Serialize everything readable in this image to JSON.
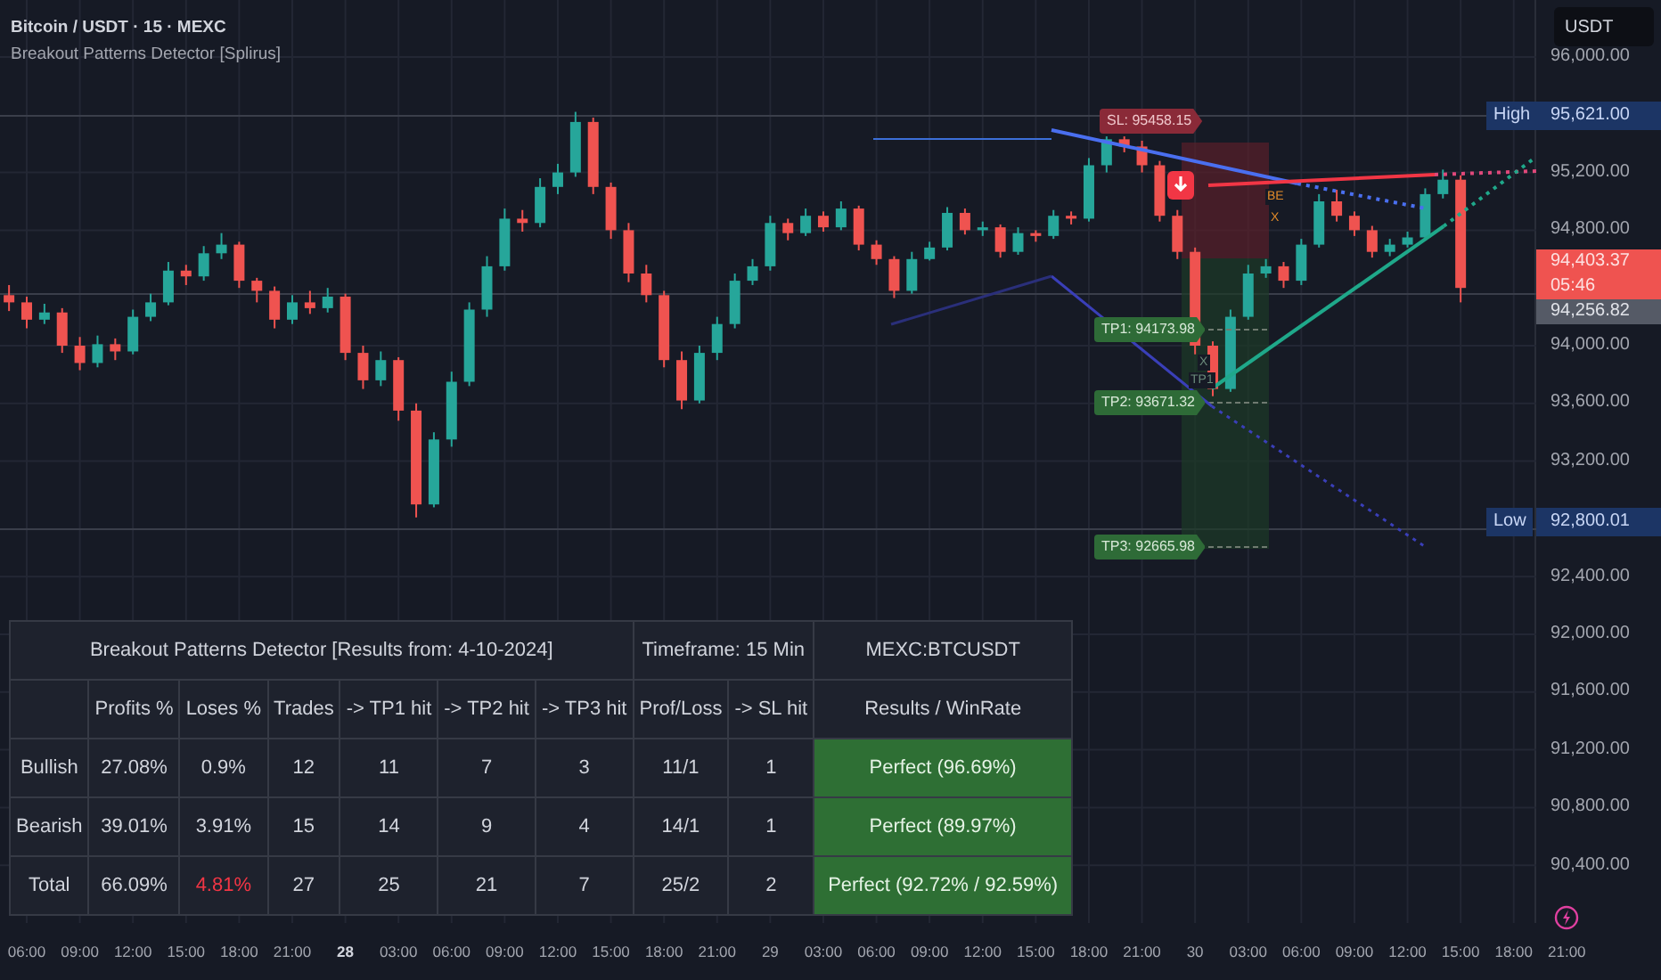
{
  "header": {
    "symbol": "Bitcoin / USDT · 15 · MEXC",
    "indicator": "Breakout Patterns Detector [Splirus]"
  },
  "price_chart": {
    "chart_data": {
      "type": "candlestick",
      "categories": [
        null,
        null,
        null,
        null,
        null,
        null,
        null,
        null,
        null,
        null,
        null,
        null,
        null,
        null,
        null,
        null,
        null,
        null,
        null,
        null,
        null,
        null,
        null,
        null,
        null,
        null,
        null,
        null,
        null,
        null,
        null,
        null,
        null,
        null,
        null,
        null,
        null,
        null,
        null,
        null,
        null,
        null,
        null,
        null,
        null,
        null,
        null,
        null,
        null,
        null,
        null,
        null,
        null,
        null,
        null,
        null,
        null,
        null,
        null,
        null,
        null,
        null,
        null,
        null,
        null,
        null,
        null,
        null,
        null,
        null,
        null,
        null,
        null,
        null,
        null,
        null,
        null,
        null,
        null,
        null,
        null,
        null,
        null
      ],
      "ohlc": [
        [
          94350,
          94420,
          94240,
          94300
        ],
        [
          94300,
          94340,
          94120,
          94180
        ],
        [
          94180,
          94290,
          94150,
          94230
        ],
        [
          94230,
          94260,
          93950,
          94000
        ],
        [
          94000,
          94060,
          93830,
          93880
        ],
        [
          93880,
          94070,
          93850,
          94010
        ],
        [
          94010,
          94050,
          93900,
          93960
        ],
        [
          93960,
          94250,
          93940,
          94200
        ],
        [
          94200,
          94360,
          94170,
          94300
        ],
        [
          94300,
          94580,
          94280,
          94520
        ],
        [
          94520,
          94560,
          94420,
          94480
        ],
        [
          94480,
          94690,
          94450,
          94640
        ],
        [
          94640,
          94780,
          94600,
          94700
        ],
        [
          94700,
          94720,
          94400,
          94450
        ],
        [
          94450,
          94470,
          94300,
          94380
        ],
        [
          94380,
          94410,
          94120,
          94180
        ],
        [
          94180,
          94350,
          94150,
          94300
        ],
        [
          94300,
          94380,
          94220,
          94260
        ],
        [
          94260,
          94400,
          94230,
          94340
        ],
        [
          94340,
          94360,
          93900,
          93950
        ],
        [
          93950,
          94000,
          93700,
          93760
        ],
        [
          93760,
          93960,
          93720,
          93900
        ],
        [
          93900,
          93920,
          93480,
          93550
        ],
        [
          93550,
          93600,
          92810,
          92900
        ],
        [
          92900,
          93400,
          92880,
          93350
        ],
        [
          93350,
          93820,
          93300,
          93750
        ],
        [
          93750,
          94300,
          93720,
          94250
        ],
        [
          94250,
          94620,
          94200,
          94550
        ],
        [
          94550,
          94950,
          94520,
          94880
        ],
        [
          94880,
          94940,
          94790,
          94850
        ],
        [
          94850,
          95160,
          94820,
          95100
        ],
        [
          95100,
          95260,
          95050,
          95200
        ],
        [
          95200,
          95620,
          95170,
          95550
        ],
        [
          95550,
          95580,
          95050,
          95100
        ],
        [
          95100,
          95130,
          94740,
          94800
        ],
        [
          94800,
          94850,
          94440,
          94500
        ],
        [
          94500,
          94560,
          94300,
          94350
        ],
        [
          94350,
          94380,
          93850,
          93900
        ],
        [
          93900,
          93960,
          93560,
          93620
        ],
        [
          93620,
          94000,
          93600,
          93950
        ],
        [
          93950,
          94200,
          93900,
          94150
        ],
        [
          94150,
          94500,
          94120,
          94450
        ],
        [
          94450,
          94600,
          94420,
          94550
        ],
        [
          94550,
          94900,
          94520,
          94850
        ],
        [
          94850,
          94880,
          94730,
          94780
        ],
        [
          94780,
          94950,
          94760,
          94900
        ],
        [
          94900,
          94930,
          94790,
          94820
        ],
        [
          94820,
          95000,
          94800,
          94950
        ],
        [
          94950,
          94970,
          94660,
          94700
        ],
        [
          94700,
          94730,
          94560,
          94600
        ],
        [
          94600,
          94620,
          94330,
          94380
        ],
        [
          94380,
          94650,
          94360,
          94600
        ],
        [
          94600,
          94720,
          94590,
          94680
        ],
        [
          94680,
          94960,
          94660,
          94920
        ],
        [
          94920,
          94950,
          94770,
          94800
        ],
        [
          94800,
          94860,
          94760,
          94820
        ],
        [
          94820,
          94840,
          94610,
          94650
        ],
        [
          94650,
          94820,
          94630,
          94780
        ],
        [
          94780,
          94800,
          94720,
          94760
        ],
        [
          94760,
          94940,
          94740,
          94900
        ],
        [
          94900,
          94930,
          94840,
          94880
        ],
        [
          94880,
          95300,
          94860,
          95250
        ],
        [
          95250,
          95450,
          95200,
          95430
        ],
        [
          95430,
          95450,
          95340,
          95380
        ],
        [
          95380,
          95420,
          95200,
          95250
        ],
        [
          95250,
          95280,
          94860,
          94900
        ],
        [
          94900,
          94940,
          94600,
          94650
        ],
        [
          94650,
          94680,
          93940,
          94000
        ],
        [
          94000,
          94030,
          93650,
          93700
        ],
        [
          93700,
          94250,
          93680,
          94200
        ],
        [
          94200,
          94560,
          94180,
          94500
        ],
        [
          94500,
          94600,
          94470,
          94550
        ],
        [
          94550,
          94580,
          94400,
          94450
        ],
        [
          94450,
          94740,
          94420,
          94700
        ],
        [
          94700,
          95050,
          94680,
          95000
        ],
        [
          95000,
          95080,
          94860,
          94900
        ],
        [
          94900,
          94930,
          94760,
          94800
        ],
        [
          94800,
          94830,
          94610,
          94650
        ],
        [
          94650,
          94740,
          94620,
          94700
        ],
        [
          94700,
          94790,
          94680,
          94750
        ],
        [
          94750,
          95090,
          94730,
          95050
        ],
        [
          95050,
          95220,
          95020,
          95150
        ],
        [
          95150,
          95180,
          94300,
          94400
        ]
      ],
      "yticks": [
        {
          "value": 96000,
          "label": "96,000.00"
        },
        {
          "value": 95200,
          "label": "95,200.00"
        },
        {
          "value": 94800,
          "label": "94,800.00"
        },
        {
          "value": 94000,
          "label": "94,000.00"
        },
        {
          "value": 93600,
          "label": "93,600.00"
        },
        {
          "value": 93200,
          "label": "93,200.00"
        },
        {
          "value": 92400,
          "label": "92,400.00"
        },
        {
          "value": 92000,
          "label": "92,000.00"
        },
        {
          "value": 91600,
          "label": "91,600.00"
        },
        {
          "value": 91200,
          "label": "91,200.00"
        },
        {
          "value": 90800,
          "label": "90,800.00"
        },
        {
          "value": 90400,
          "label": "90,400.00"
        }
      ],
      "ylim": [
        90000,
        96395
      ],
      "grid": true
    },
    "time_axis": [
      {
        "text": "06:00",
        "bold": false
      },
      {
        "text": "09:00",
        "bold": false
      },
      {
        "text": "12:00",
        "bold": false
      },
      {
        "text": "15:00",
        "bold": false
      },
      {
        "text": "18:00",
        "bold": false
      },
      {
        "text": "21:00",
        "bold": false
      },
      {
        "text": "28",
        "bold": true
      },
      {
        "text": "03:00",
        "bold": false
      },
      {
        "text": "06:00",
        "bold": false
      },
      {
        "text": "09:00",
        "bold": false
      },
      {
        "text": "12:00",
        "bold": false
      },
      {
        "text": "15:00",
        "bold": false
      },
      {
        "text": "18:00",
        "bold": false
      },
      {
        "text": "21:00",
        "bold": false
      },
      {
        "text": "29",
        "bold": false
      },
      {
        "text": "03:00",
        "bold": false
      },
      {
        "text": "06:00",
        "bold": false
      },
      {
        "text": "09:00",
        "bold": false
      },
      {
        "text": "12:00",
        "bold": false
      },
      {
        "text": "15:00",
        "bold": false
      },
      {
        "text": "18:00",
        "bold": false
      },
      {
        "text": "21:00",
        "bold": false
      },
      {
        "text": "30",
        "bold": false
      },
      {
        "text": "03:00",
        "bold": false
      },
      {
        "text": "06:00",
        "bold": false
      },
      {
        "text": "09:00",
        "bold": false
      },
      {
        "text": "12:00",
        "bold": false
      },
      {
        "text": "15:00",
        "bold": false
      },
      {
        "text": "18:00",
        "bold": false
      },
      {
        "text": "21:00",
        "bold": false
      }
    ]
  },
  "price_axis": {
    "currency": "USDT",
    "markers": [
      {
        "kind": "high",
        "label": "High",
        "value": "95,621.00"
      },
      {
        "kind": "last",
        "value": "94,403.37",
        "countdown": "05:46"
      },
      {
        "kind": "previous",
        "value": "94,256.82"
      },
      {
        "kind": "low",
        "label": "Low",
        "value": "92,800.01"
      }
    ]
  },
  "trade_labels": [
    {
      "kind": "sl",
      "text": "SL: 95458.15"
    },
    {
      "kind": "tp",
      "text": "TP1: 94173.98"
    },
    {
      "kind": "tp",
      "text": "TP2: 93671.32"
    },
    {
      "kind": "tp",
      "text": "TP3: 92665.98"
    }
  ],
  "chart_marks": [
    {
      "kind": "be",
      "text": "BE"
    },
    {
      "kind": "be",
      "text": "X"
    },
    {
      "kind": "tp",
      "text": "X"
    },
    {
      "kind": "tp",
      "text": "TP1"
    }
  ],
  "table": {
    "title": "Breakout Patterns Detector [Results from: 4-10-2024]",
    "timeframe": "Timeframe: 15 Min",
    "market": "MEXC:BTCUSDT",
    "columns": [
      "Profits %",
      "Loses %",
      "Trades",
      "-> TP1 hit",
      "-> TP2 hit",
      "-> TP3 hit",
      "Prof/Loss",
      "-> SL hit",
      "Results / WinRate"
    ],
    "rows": [
      {
        "label": "Bullish",
        "loss_alert": false,
        "cells": [
          "27.08%",
          "0.9%",
          "12",
          "11",
          "7",
          "3",
          "11/1",
          "1",
          "Perfect (96.69%)"
        ]
      },
      {
        "label": "Bearish",
        "loss_alert": false,
        "cells": [
          "39.01%",
          "3.91%",
          "15",
          "14",
          "9",
          "4",
          "14/1",
          "1",
          "Perfect (89.97%)"
        ]
      },
      {
        "label": "Total",
        "loss_alert": true,
        "cells": [
          "66.09%",
          "4.81%",
          "27",
          "25",
          "21",
          "7",
          "25/2",
          "2",
          "Perfect (92.72% / 92.59%)"
        ]
      }
    ]
  }
}
